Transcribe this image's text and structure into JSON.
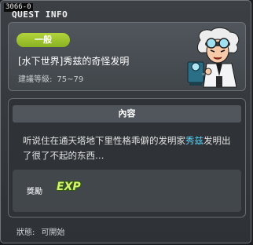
{
  "window": {
    "id_label": "3066-0",
    "title": "QUEST INFO"
  },
  "header": {
    "category": "一般",
    "quest_name": "[水下世界]秀兹的奇怪发明",
    "level_label": "建議等級:",
    "level_range": "75~79"
  },
  "content": {
    "heading": "內容",
    "description_before": "听说住在通天塔地下里性格乖僻的发明家",
    "npc_name": "秀兹",
    "description_after": "发明出了很了不起的东西…",
    "reward_label": "獎勵",
    "reward_icon_text": "EXP"
  },
  "status": {
    "label": "狀態:",
    "value": "可開始"
  },
  "colors": {
    "category_badge": "#9cc22c",
    "npc_name_highlight": "#56d6ff",
    "exp_icon": "#d7f26c"
  }
}
